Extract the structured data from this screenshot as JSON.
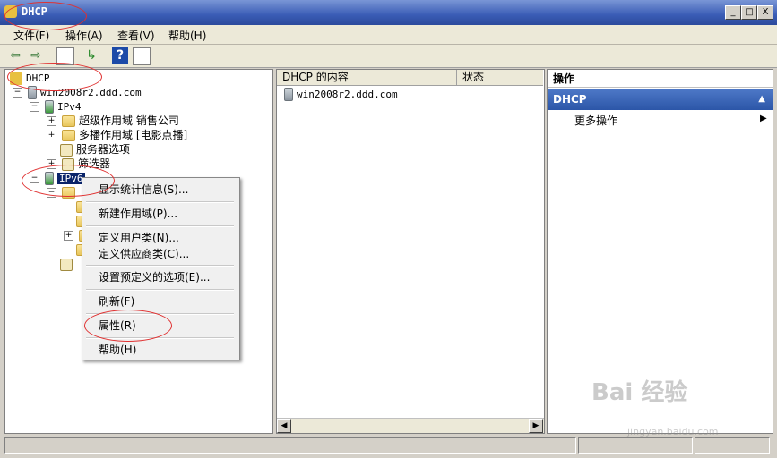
{
  "window": {
    "title": "DHCP",
    "minimize": "_",
    "maximize": "□",
    "close": "X"
  },
  "menubar": [
    {
      "label": "文件(F)"
    },
    {
      "label": "操作(A)"
    },
    {
      "label": "查看(V)"
    },
    {
      "label": "帮助(H)"
    }
  ],
  "toolbar": {
    "back": "⇦",
    "forward": "⇨",
    "help": "?"
  },
  "tree": {
    "root": "DHCP",
    "server": "win2008r2.ddd.com",
    "ipv4": "IPv4",
    "superscope": "超级作用域 销售公司",
    "multicast": "多播作用域 [电影点播]",
    "server_options": "服务器选项",
    "filters": "筛选器",
    "ipv6": "IPv6"
  },
  "content": {
    "col_name": "DHCP 的内容",
    "col_status": "状态",
    "rows": [
      {
        "name": "win2008r2.ddd.com"
      }
    ]
  },
  "actions": {
    "header": "操作",
    "section": "DHCP",
    "more": "更多操作",
    "more_arrow": "▶",
    "collapse_arrow": "▲"
  },
  "context_menu": {
    "show_stats": "显示统计信息(S)...",
    "new_scope": "新建作用域(P)...",
    "define_user_class": "定义用户类(N)...",
    "define_vendor_class": "定义供应商类(C)...",
    "set_predefined": "设置预定义的选项(E)...",
    "refresh": "刷新(F)",
    "properties": "属性(R)",
    "help": "帮助(H)"
  },
  "watermark": {
    "main": "Bai 经验",
    "sub": "jingyan.baidu.com"
  }
}
